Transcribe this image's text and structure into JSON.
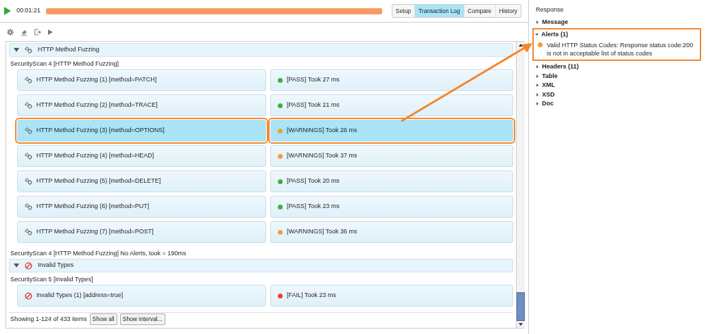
{
  "run_bar": {
    "elapsed": "00:01:21",
    "level": 1.0
  },
  "tabs": [
    {
      "label": "Setup",
      "selected": false
    },
    {
      "label": "Transaction Log",
      "selected": true
    },
    {
      "label": "Compare",
      "selected": false
    },
    {
      "label": "History",
      "selected": false
    }
  ],
  "sections": [
    {
      "title": "HTTP Method Fuzzing",
      "kind": "fuzz",
      "expanded": true,
      "scan_label": "SecurityScan 4 [HTTP Method Fuzzing]",
      "rows": [
        {
          "label": "HTTP Method Fuzzing (1) [method=PATCH]",
          "result": "[PASS] Took 27 ms",
          "color": "#3cb043",
          "selected": false
        },
        {
          "label": "HTTP Method Fuzzing (2) [method=TRACE]",
          "result": "[PASS] Took 21 ms",
          "color": "#3cb043",
          "selected": false
        },
        {
          "label": "HTTP Method Fuzzing (3) [method=OPTIONS]",
          "result": "[WARNINGS] Took 26 ms",
          "color": "#f0a030",
          "selected": true
        },
        {
          "label": "HTTP Method Fuzzing (4) [method=HEAD]",
          "result": "[WARNINGS] Took 37 ms",
          "color": "#f0a030",
          "selected": false
        },
        {
          "label": "HTTP Method Fuzzing (5) [method=DELETE]",
          "result": "[PASS] Took 20 ms",
          "color": "#3cb043",
          "selected": false
        },
        {
          "label": "HTTP Method Fuzzing (6) [method=PUT]",
          "result": "[PASS] Took 23 ms",
          "color": "#3cb043",
          "selected": false
        },
        {
          "label": "HTTP Method Fuzzing (7) [method=POST]",
          "result": "[WARNINGS] Took 36 ms",
          "color": "#f0a030",
          "selected": false
        }
      ],
      "summary": "SecurityScan 4 [HTTP Method Fuzzing] No Alerts, took = 190ms"
    },
    {
      "title": "Invalid Types",
      "kind": "blocked",
      "expanded": true,
      "scan_label": "SecurityScan 5 [Invalid Types]",
      "rows": [
        {
          "label": "Invalid Types (1) [address=true]",
          "result": "[FAIL] Took 23 ms",
          "color": "#e8402a",
          "selected": false
        }
      ]
    }
  ],
  "footer": {
    "status": "Showing 1-124 of 433 items",
    "buttons": [
      "Show all",
      "Show interval..."
    ]
  },
  "response": {
    "title": "Response",
    "items": [
      {
        "label": "Message",
        "expanded": false
      },
      {
        "label": "Alerts (1)",
        "expanded": true,
        "highlighted": true,
        "alerts": [
          {
            "text": "Valid HTTP Status Codes: Response status code:200 is not in acceptable list of status codes",
            "color": "#f0a030"
          }
        ]
      },
      {
        "label": "Headers (11)",
        "expanded": false
      },
      {
        "label": "Table",
        "expanded": false
      },
      {
        "label": "XML",
        "expanded": false
      },
      {
        "label": "XSD",
        "expanded": false
      },
      {
        "label": "Doc",
        "expanded": false
      }
    ]
  }
}
